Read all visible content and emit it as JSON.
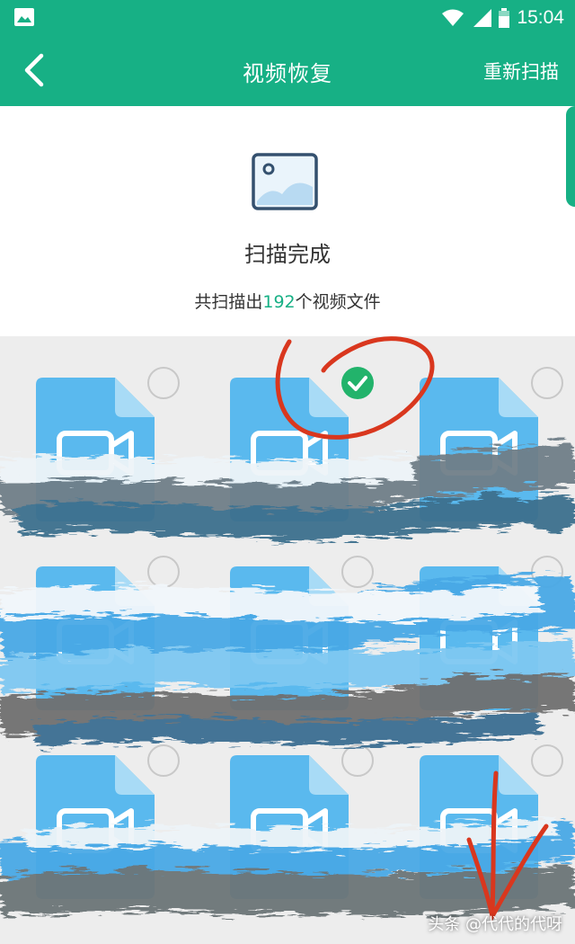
{
  "status_bar": {
    "time": "15:04",
    "icons": [
      "image-icon",
      "wifi-icon",
      "signal-icon",
      "battery-icon"
    ]
  },
  "app_bar": {
    "back_icon": "chevron-left-icon",
    "title": "视频恢复",
    "rescan_label": "重新扫描"
  },
  "summary": {
    "icon": "picture-icon",
    "status": "扫描完成",
    "count_prefix": "共扫描出",
    "count_value": "192",
    "count_suffix": "个视频文件"
  },
  "files": [
    {
      "selected": false
    },
    {
      "selected": true
    },
    {
      "selected": false
    },
    {
      "selected": false
    },
    {
      "selected": false
    },
    {
      "selected": false
    },
    {
      "selected": false
    },
    {
      "selected": false
    },
    {
      "selected": false
    }
  ],
  "watermark": "头条 @代代的代呀",
  "colors": {
    "accent": "#17b085",
    "file_blue": "#5ab9ee",
    "file_fold": "#a8dbf6",
    "check_green": "#22b36b",
    "annotation_red": "#d9371e"
  }
}
